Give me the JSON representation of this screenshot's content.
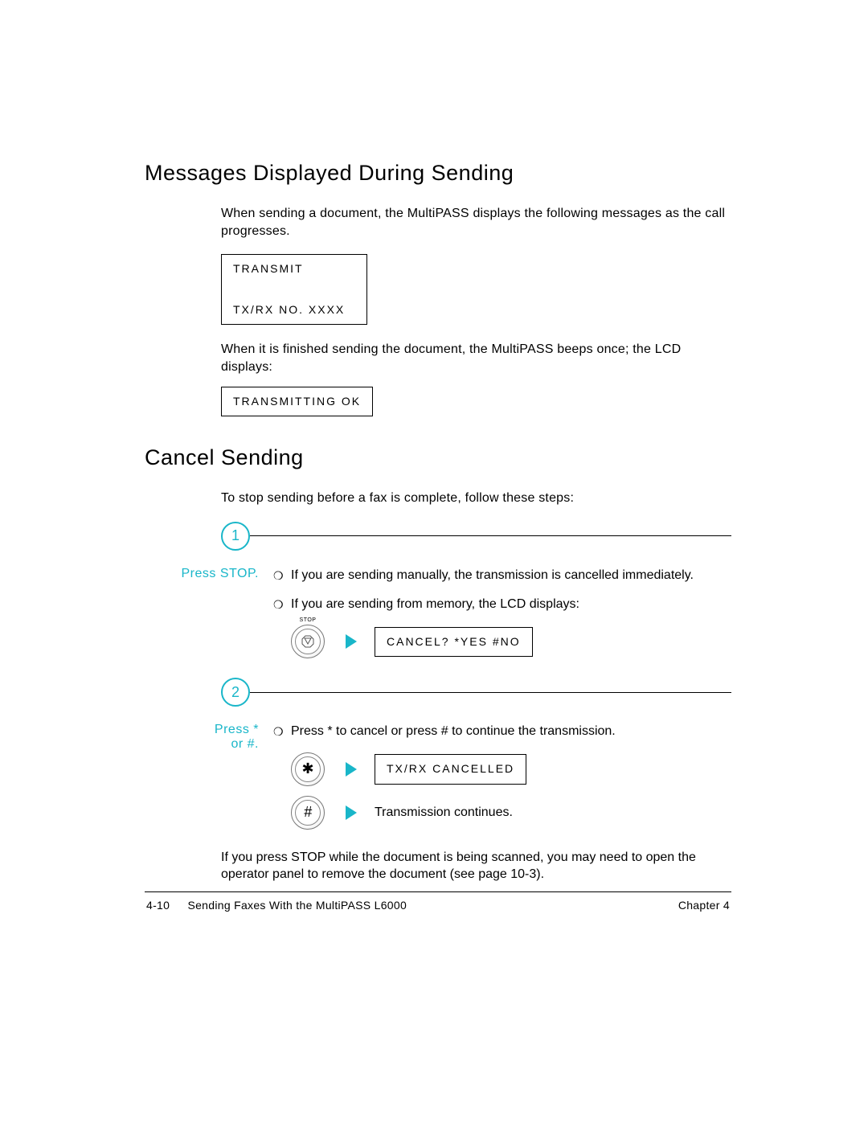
{
  "headings": {
    "h1a": "Messages Displayed During Sending",
    "h1b": "Cancel Sending"
  },
  "paragraphs": {
    "intro1": "When sending a document, the MultiPASS displays the following messages as the call progresses.",
    "intro2": "When it is finished sending the document, the MultiPASS beeps once; the LCD displays:",
    "cancel_intro": "To stop sending before a fax is complete, follow these steps:",
    "note": "If you press STOP while the document is being scanned, you may need to open the operator panel to remove the document (see page 10-3)."
  },
  "lcd": {
    "transmit": "TRANSMIT",
    "txrxno": "TX/RX NO.   XXXX",
    "transmitting_ok": "TRANSMITTING OK",
    "cancel_prompt": "CANCEL? *YES #NO",
    "txrx_cancelled": "TX/RX CANCELLED"
  },
  "steps": {
    "s1": {
      "num": "1",
      "left": "Press STOP.",
      "bullets": {
        "b1": "If you are sending manually, the transmission is cancelled immediately.",
        "b2": "If you are sending from memory, the LCD displays:"
      },
      "stop_label": "STOP"
    },
    "s2": {
      "num": "2",
      "left_line1": "Press *",
      "left_line2": "or #.",
      "bullet": "Press * to cancel or press # to continue the transmission.",
      "star": "✱",
      "hash": "#",
      "continues": "Transmission continues."
    }
  },
  "footer": {
    "page_num": "4-10",
    "title": "Sending Faxes With the MultiPASS L6000",
    "chapter": "Chapter 4"
  },
  "glyphs": {
    "bullet": "❍"
  }
}
